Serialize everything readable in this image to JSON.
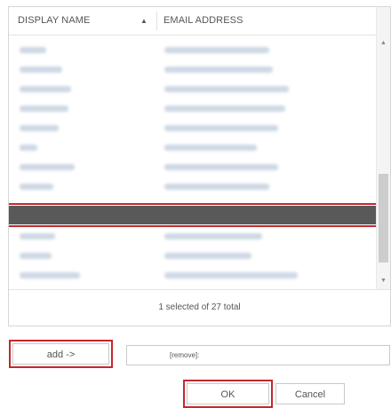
{
  "table": {
    "columns": {
      "display_name": "DISPLAY NAME",
      "sort_indicator": "▲",
      "email_address": "EMAIL ADDRESS"
    },
    "rows": [
      {
        "blurred": true
      },
      {
        "blurred": true
      },
      {
        "blurred": true
      },
      {
        "blurred": true
      },
      {
        "blurred": true
      },
      {
        "blurred": true
      },
      {
        "blurred": true
      },
      {
        "blurred": true
      },
      {
        "blurred": true,
        "selected": true
      },
      {
        "blurred": true
      },
      {
        "blurred": true
      },
      {
        "blurred": true
      },
      {
        "blurred": true
      }
    ],
    "status": "1 selected of 27 total"
  },
  "scrollbar": {
    "up_arrow": "▲",
    "down_arrow": "▼"
  },
  "actions": {
    "add_label": "add ->",
    "remove_value": "[remove]:",
    "ok_label": "OK",
    "cancel_label": "Cancel"
  },
  "colors": {
    "highlight": "#c4282e",
    "selected_row": "#595959"
  }
}
